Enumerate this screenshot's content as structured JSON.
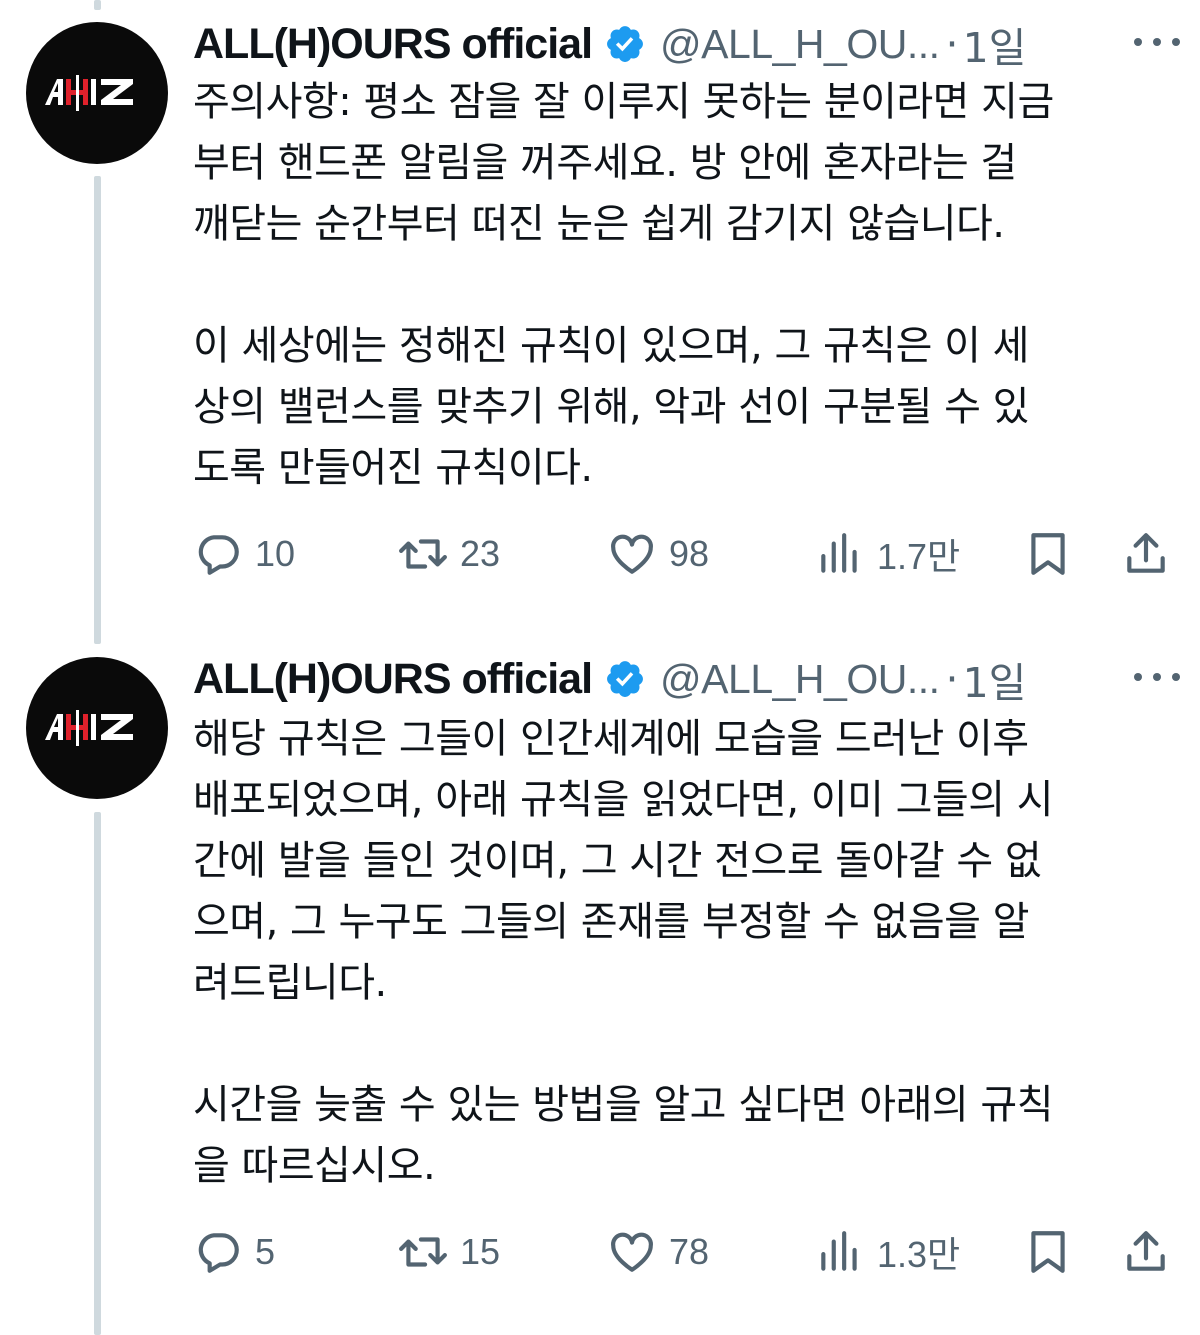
{
  "tweets": [
    {
      "author": {
        "name": "ALL(H)OURS official",
        "handle": "@ALL_H_OU...",
        "avatar_text": "AHS",
        "avatar_bg": "#0a0a0a",
        "avatar_accent": "#e0212b"
      },
      "separator": "·",
      "time": "1일",
      "body": "주의사항: 평소 잠을 잘 이루지 못하는 분이라면 지금\n부터 핸드폰 알림을 꺼주세요. 방 안에 혼자라는 걸\n깨닫는 순간부터 떠진 눈은 쉽게 감기지 않습니다.\n\n이 세상에는 정해진 규칙이 있으며, 그 규칙은 이 세\n상의 밸런스를 맞추기 위해, 악과 선이 구분될 수 있\n도록 만들어진 규칙이다.",
      "stats": {
        "replies": "10",
        "reposts": "23",
        "likes": "98",
        "views": "1.7만"
      }
    },
    {
      "author": {
        "name": "ALL(H)OURS official",
        "handle": "@ALL_H_OU...",
        "avatar_text": "AHS",
        "avatar_bg": "#0a0a0a",
        "avatar_accent": "#e0212b"
      },
      "separator": "·",
      "time": "1일",
      "body": "해당 규칙은 그들이 인간세계에 모습을 드러난 이후\n배포되었으며, 아래 규칙을 읽었다면, 이미 그들의 시\n간에 발을 들인 것이며, 그 시간 전으로 돌아갈 수 없\n으며, 그 누구도 그들의 존재를 부정할 수 없음을 알\n려드립니다.\n\n시간을 늦출 수 있는 방법을 알고 싶다면 아래의 규칙\n을 따르십시오.",
      "stats": {
        "replies": "5",
        "reposts": "15",
        "likes": "78",
        "views": "1.3만"
      }
    }
  ],
  "icons": {
    "verified": "verified-badge-icon",
    "more": "more-horizontal-icon",
    "reply": "reply-bubble-icon",
    "repost": "repost-arrows-icon",
    "like": "heart-icon",
    "views": "bar-chart-icon",
    "bookmark": "bookmark-icon",
    "share": "share-upload-icon"
  },
  "colors": {
    "verified_blue": "#1d9bf0",
    "text": "#0f1419",
    "muted": "#536471",
    "thread_line": "#cfd9de"
  }
}
